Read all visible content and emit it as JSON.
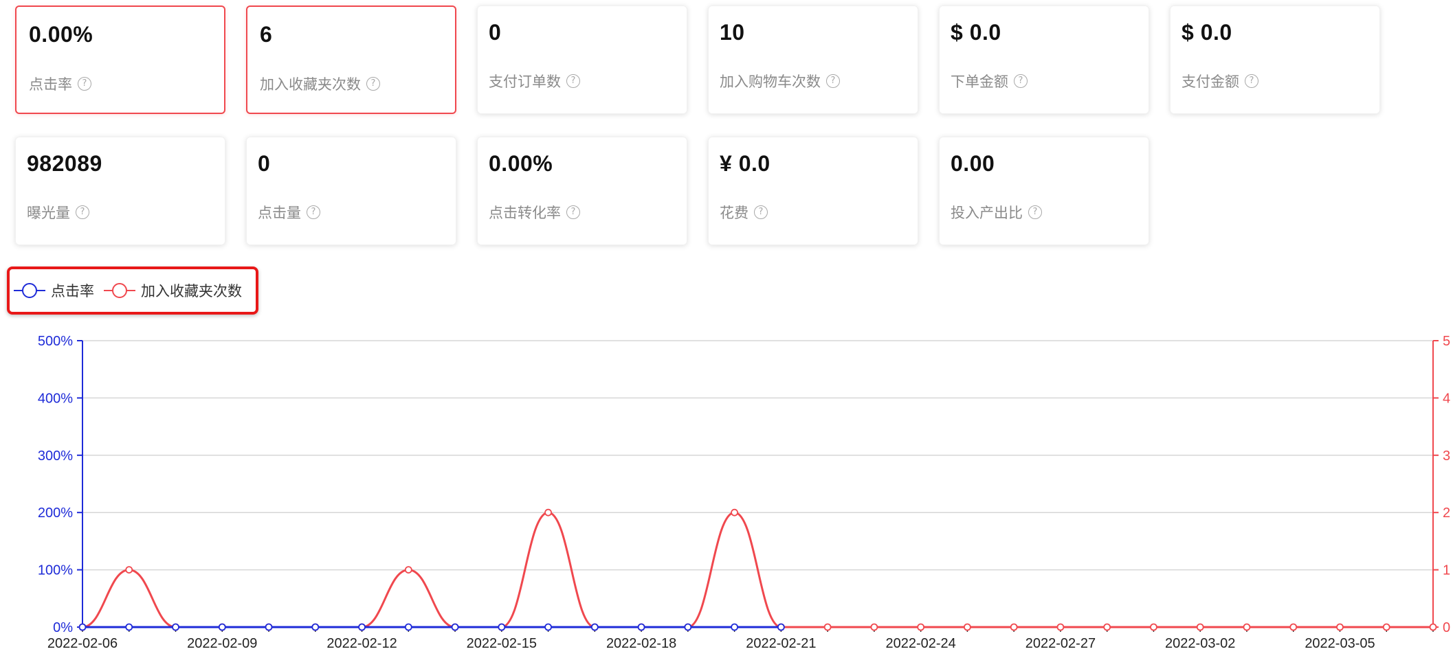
{
  "cards": [
    {
      "value": "0.00%",
      "label": "点击率",
      "selected": true
    },
    {
      "value": "6",
      "label": "加入收藏夹次数",
      "selected": true
    },
    {
      "value": "0",
      "label": "支付订单数",
      "selected": false
    },
    {
      "value": "10",
      "label": "加入购物车次数",
      "selected": false
    },
    {
      "value": "$ 0.0",
      "label": "下单金额",
      "selected": false
    },
    {
      "value": "$ 0.0",
      "label": "支付金额",
      "selected": false
    },
    {
      "value": "982089",
      "label": "曝光量",
      "selected": false
    },
    {
      "value": "0",
      "label": "点击量",
      "selected": false
    },
    {
      "value": "0.00%",
      "label": "点击转化率",
      "selected": false
    },
    {
      "value": "¥ 0.0",
      "label": "花费",
      "selected": false
    },
    {
      "value": "0.00",
      "label": "投入产出比",
      "selected": false
    }
  ],
  "help_icon": "question-circle-icon",
  "legend": [
    {
      "label": "点击率",
      "color": "#1e2bd8"
    },
    {
      "label": "加入收藏夹次数",
      "color": "#f0484e"
    }
  ],
  "chart_data": {
    "type": "line",
    "smooth": true,
    "x": [
      "2022-02-06",
      "2022-02-07",
      "2022-02-08",
      "2022-02-09",
      "2022-02-10",
      "2022-02-11",
      "2022-02-12",
      "2022-02-13",
      "2022-02-14",
      "2022-02-15",
      "2022-02-16",
      "2022-02-17",
      "2022-02-18",
      "2022-02-19",
      "2022-02-20",
      "2022-02-21",
      "2022-02-22",
      "2022-02-23",
      "2022-02-24",
      "2022-02-25",
      "2022-02-26",
      "2022-02-27",
      "2022-02-28",
      "2022-03-01",
      "2022-03-02",
      "2022-03-03",
      "2022-03-04",
      "2022-03-05",
      "2022-03-06",
      "2022-03-07"
    ],
    "x_tick_labels": [
      "2022-02-06",
      "2022-02-09",
      "2022-02-12",
      "2022-02-15",
      "2022-02-18",
      "2022-02-21",
      "2022-02-24",
      "2022-02-27",
      "2022-03-02",
      "2022-03-05"
    ],
    "series": [
      {
        "name": "点击率",
        "axis": "left",
        "color": "#1e2bd8",
        "end_index": 15,
        "values": [
          0,
          0,
          0,
          0,
          0,
          0,
          0,
          0,
          0,
          0,
          0,
          0,
          0,
          0,
          0,
          0
        ]
      },
      {
        "name": "加入收藏夹次数",
        "axis": "right",
        "color": "#f0484e",
        "values": [
          0,
          1,
          0,
          0,
          0,
          0,
          0,
          1,
          0,
          0,
          2,
          0,
          0,
          0,
          2,
          0,
          0,
          0,
          0,
          0,
          0,
          0,
          0,
          0,
          0,
          0,
          0,
          0,
          0,
          0
        ]
      }
    ],
    "y_left": {
      "min": 0,
      "max": 5,
      "ticks": [
        "0%",
        "100%",
        "200%",
        "300%",
        "400%",
        "500%"
      ],
      "color": "#1e2bd8"
    },
    "y_right": {
      "min": 0,
      "max": 5,
      "ticks": [
        "0",
        "1",
        "2",
        "3",
        "4",
        "5"
      ],
      "color": "#f0484e"
    },
    "grid": true,
    "legend_position": "top-left"
  }
}
